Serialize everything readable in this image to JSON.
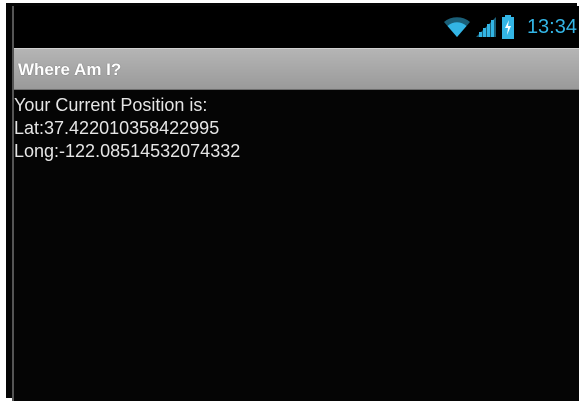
{
  "status_bar": {
    "time": "13:34",
    "icons": [
      "wifi-icon",
      "signal-icon",
      "battery-charging-icon"
    ],
    "accent_color": "#33b5e5"
  },
  "app": {
    "title": "Where Am I?"
  },
  "content": {
    "heading": "Your Current Position is:",
    "latitude": "Lat:37.422010358422995",
    "longitude": "Long:-122.08514532074332"
  }
}
